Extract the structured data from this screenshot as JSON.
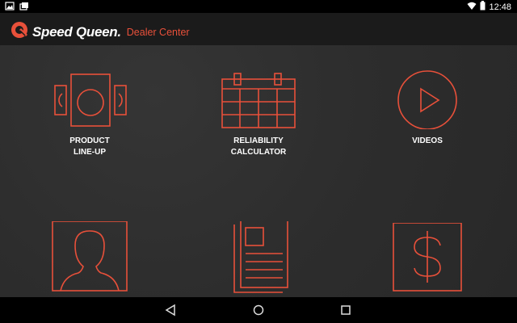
{
  "status_bar": {
    "time": "12:48",
    "icons": [
      "image-icon",
      "photo-stack-icon",
      "wifi-icon",
      "battery-icon"
    ]
  },
  "app_bar": {
    "brand": "Speed Queen.",
    "subtitle": "Dealer Center",
    "logo_icon": "q-logo-icon"
  },
  "colors": {
    "accent": "#e8503a",
    "background": "#2c2c2c",
    "app_bar": "#1b1b1b"
  },
  "tiles": [
    {
      "label": "PRODUCT\nLINE-UP",
      "icon": "product-lineup-icon"
    },
    {
      "label": "RELIABILITY\nCALCULATOR",
      "icon": "calendar-icon"
    },
    {
      "label": "VIDEOS",
      "icon": "play-icon"
    },
    {
      "label": "",
      "icon": "person-profile-icon"
    },
    {
      "label": "",
      "icon": "document-icon"
    },
    {
      "label": "",
      "icon": "dollar-icon"
    }
  ],
  "nav_bar": {
    "buttons": [
      "back-icon",
      "home-icon",
      "recents-icon"
    ]
  }
}
